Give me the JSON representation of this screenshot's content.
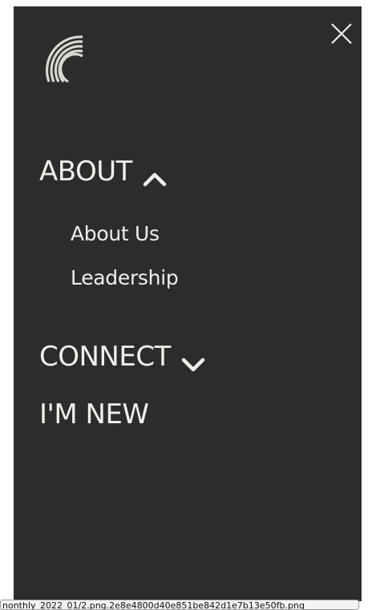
{
  "menu": {
    "logo_icon": "arc-rings-logo-icon",
    "close_icon": "close-x-icon",
    "items": [
      {
        "label": "ABOUT",
        "icon": "chevron-up-icon",
        "expanded": true
      },
      {
        "label": "CONNECT",
        "icon": "chevron-down-icon",
        "expanded": false
      },
      {
        "label": "I'M NEW"
      }
    ],
    "about_submenu": [
      {
        "label": "About Us"
      },
      {
        "label": "Leadership"
      }
    ]
  },
  "tooltip": {
    "text": "nonthly_2022_01/2.png.2e8e4800d40e851be842d1e7b13e50fb.png"
  },
  "colors": {
    "panel_bg": "#2c2c2c",
    "text": "#f0efe9"
  }
}
